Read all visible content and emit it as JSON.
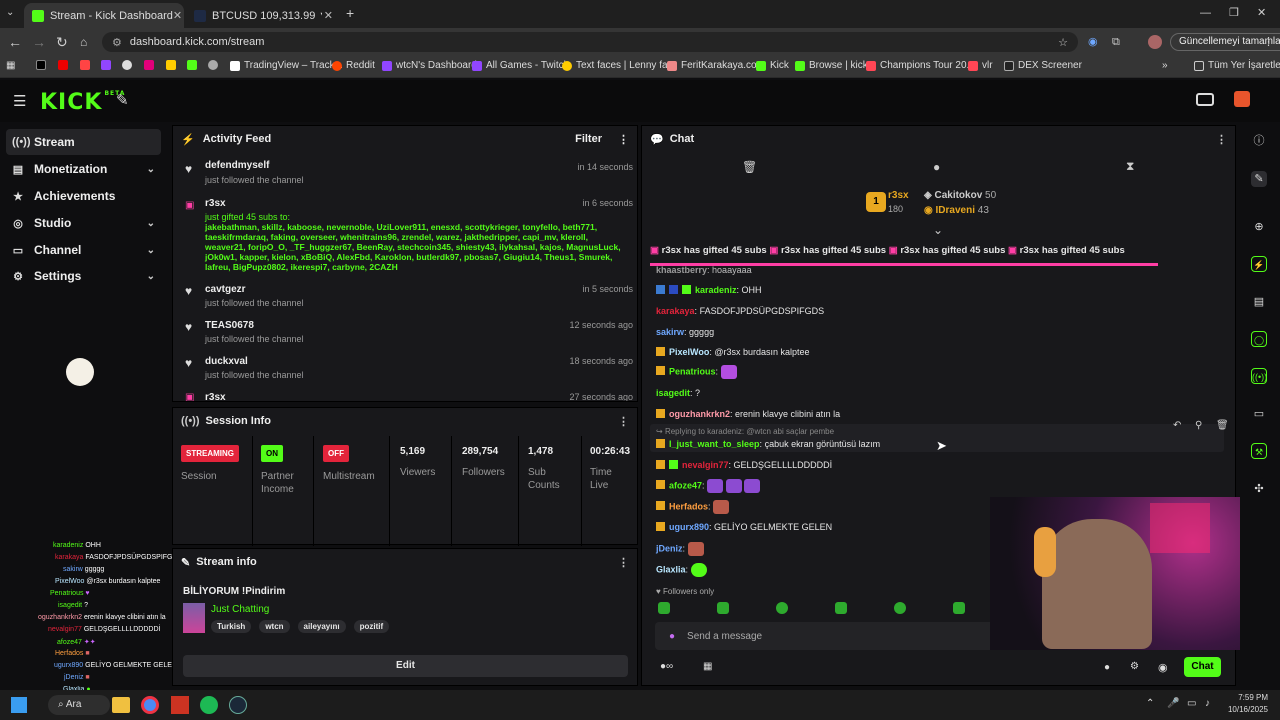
{
  "browser": {
    "tabs": [
      {
        "title": "Stream - Kick Dashboard",
        "active": true
      },
      {
        "title": "BTCUSD 109,313.99 ▼ −1.34%",
        "active": false
      }
    ],
    "url": "dashboard.kick.com/stream",
    "update_label": "Güncellemeyi tamamla",
    "bookmarks": [
      "TradingView – Track...",
      "Reddit",
      "wtcN's Dashboard",
      "All Games - Twitch",
      "Text faces | Lenny fa...",
      "FeritKarakaya.com",
      "Kick",
      "Browse | kick",
      "Champions Tour 20...",
      "vlr",
      "DEX Screener"
    ],
    "all_bookmarks": "Tüm Yer İşaretleri"
  },
  "sidebar": {
    "items": [
      {
        "label": "Stream",
        "icon": "broadcast-icon",
        "active": true,
        "expandable": false
      },
      {
        "label": "Monetization",
        "icon": "money-icon",
        "active": false,
        "expandable": true
      },
      {
        "label": "Achievements",
        "icon": "trophy-icon",
        "active": false,
        "expandable": false
      },
      {
        "label": "Studio",
        "icon": "studio-icon",
        "active": false,
        "expandable": true
      },
      {
        "label": "Channel",
        "icon": "channel-icon",
        "active": false,
        "expandable": true
      },
      {
        "label": "Settings",
        "icon": "gear-icon",
        "active": false,
        "expandable": true
      }
    ]
  },
  "activity": {
    "title": "Activity Feed",
    "filter": "Filter",
    "events": [
      {
        "name": "defendmyself",
        "desc": "just followed the channel",
        "time": "in 14 seconds"
      },
      {
        "name": "r3sx",
        "desc": "just gifted 45 subs to:",
        "time": "in 6 seconds",
        "recipients": "jakebathman, skillz, kaboose, nevernoble, UziLover911, enesxd, scottykrieger, tonyfello, beth771, taeskifrmdaraq, faking, overseer, whenitrains96, zrendel, warez, jakthedripper, capi_mv, kleroll, weaver21, foripO_O, _TF_huggzer67, BeenRay, stechcoin345, shiesty43, ilykahsal, kajos, MagnusLuck, jOk0w1, kapper, kielon, xBoBiQ, AlexFbd, Karoklon, butlerdk97, pbosas7, Giugiu14, Theus1, Smurek, lafreu, BigPupz0802, ikerespi7, carbyne, 2CAZH"
      },
      {
        "name": "cavtgezr",
        "desc": "just followed the channel",
        "time": "in 5 seconds"
      },
      {
        "name": "TEAS0678",
        "desc": "just followed the channel",
        "time": "12 seconds ago"
      },
      {
        "name": "duckxval",
        "desc": "just followed the channel",
        "time": "18 seconds ago"
      },
      {
        "name": "r3sx",
        "desc": "",
        "time": "27 seconds ago"
      }
    ]
  },
  "session": {
    "title": "Session Info",
    "stats": [
      {
        "value": "STREAMING",
        "label": "Session",
        "badge": true,
        "color": "#e3243b"
      },
      {
        "value": "ON",
        "label": "Partner Income",
        "badge": true,
        "color": "#53fc18"
      },
      {
        "value": "OFF",
        "label": "Multistream",
        "badge": true,
        "color": "#e3243b"
      },
      {
        "value": "5,169",
        "label": "Viewers",
        "badge": false
      },
      {
        "value": "289,754",
        "label": "Followers",
        "badge": false
      },
      {
        "value": "1,478",
        "label": "Sub Counts",
        "badge": false
      },
      {
        "value": "00:26:43",
        "label": "Time Live",
        "badge": false
      }
    ]
  },
  "stream_info": {
    "title": "Stream info",
    "stream_title": "BİLİYORUM !Pindirim",
    "category": "Just Chatting",
    "tags": [
      "Turkish",
      "wtcn",
      "aileyayını",
      "pozitif"
    ],
    "edit": "Edit"
  },
  "chat": {
    "title": "Chat",
    "leaders": [
      {
        "name": "r3sx",
        "count": "180",
        "rank": "1"
      },
      {
        "name": "Cakitokov",
        "count": "50"
      },
      {
        "name": "IDraveni",
        "count": "43"
      }
    ],
    "gift_ticker": "r3sx has gifted 45 subs",
    "messages": [
      {
        "user": "khaastberry",
        "text": "hoaayaaa",
        "color": "#bbbbbb"
      },
      {
        "user": "karadeniz",
        "text": "OHH",
        "color": "#53fc18"
      },
      {
        "user": "karakaya",
        "text": "FASDOFJPDSÜPGDSPIFGDS",
        "color": "#e3243b"
      },
      {
        "user": "sakirw",
        "text": "ggggg",
        "color": "#6fa8ff"
      },
      {
        "user": "PixelWoo",
        "text": "@r3sx burdasın kalptee",
        "color": "#b9e7ff"
      },
      {
        "user": "Penatrious",
        "text": "",
        "color": "#53fc18"
      },
      {
        "user": "isagedit",
        "text": "?",
        "color": "#53fc18"
      },
      {
        "user": "oguzhankrkn2",
        "text": "erenin klavye clibini atın la",
        "color": "#ff9aa8"
      },
      {
        "user": "I_just_want_to_sleep",
        "text": "çabuk ekran görüntüsü lazım",
        "color": "#53fc18",
        "reply": "Replying to karadeniz: @wtcn abi saçlar pembe"
      },
      {
        "user": "nevalgin77",
        "text": "GELDŞGELLLLDDDDDİ",
        "color": "#e3243b"
      },
      {
        "user": "afoze47",
        "text": "",
        "color": "#53fc18"
      },
      {
        "user": "Herfados",
        "text": "",
        "color": "#ff9f40"
      },
      {
        "user": "ugurx890",
        "text": "GELİYO GELMEKTE GELEN",
        "color": "#6fa8ff"
      },
      {
        "user": "jDeniz",
        "text": "",
        "color": "#6fa8ff"
      },
      {
        "user": "Glaxlia",
        "text": "",
        "color": "#b9e7ff"
      }
    ],
    "followers_only": "Followers only",
    "input_placeholder": "Send a message",
    "send": "Chat"
  },
  "overlay_chat": [
    {
      "user": "karadeniz",
      "text": "OHH"
    },
    {
      "user": "karakaya",
      "text": "FASDOFJPDSÜPGDSPIFGDS"
    },
    {
      "user": "sakirw",
      "text": "ggggg"
    },
    {
      "user": "PixelWoo",
      "text": "@r3sx burdasın kalptee"
    },
    {
      "user": "Penatrious",
      "text": ""
    },
    {
      "user": "isagedit",
      "text": "?"
    },
    {
      "user": "oguzhankrkn2",
      "text": "erenin klavye clibini atın la"
    },
    {
      "user": "nevalgin77",
      "text": "GELDŞGELLLLDDDDDİ"
    },
    {
      "user": "afoze47",
      "text": ""
    },
    {
      "user": "Herfados",
      "text": ""
    },
    {
      "user": "ugurx890",
      "text": "GELİYO GELMEKTE GELEN"
    },
    {
      "user": "jDeniz",
      "text": ""
    },
    {
      "user": "Glaxlia",
      "text": ""
    }
  ],
  "taskbar": {
    "search": "Ara",
    "time": "7:59 PM",
    "date": "10/16/2025"
  },
  "colors": {
    "brand": "#53fc18",
    "live": "#e3243b",
    "gift": "#ff3ea5"
  }
}
